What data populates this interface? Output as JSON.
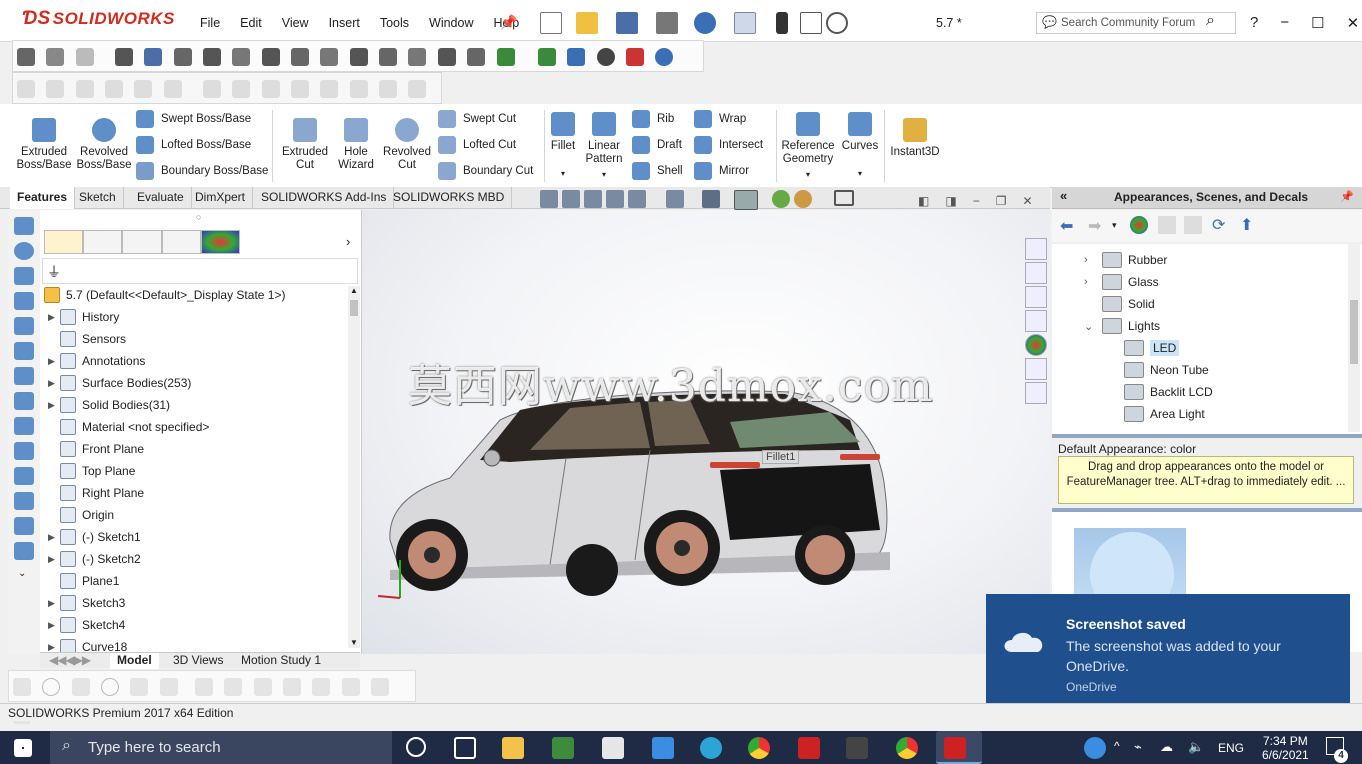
{
  "app": {
    "name": "SOLIDWORKS",
    "document_title": "5.7 *"
  },
  "menu": [
    "File",
    "Edit",
    "View",
    "Insert",
    "Tools",
    "Window",
    "Help"
  ],
  "search": {
    "placeholder": "Search Community Forum"
  },
  "command_manager": {
    "large": [
      {
        "label": "Extruded Boss/Base"
      },
      {
        "label": "Revolved Boss/Base"
      },
      {
        "label": "Extruded Cut"
      },
      {
        "label": "Hole Wizard"
      },
      {
        "label": "Revolved Cut"
      },
      {
        "label": "Fillet"
      },
      {
        "label": "Linear Pattern"
      },
      {
        "label": "Reference Geometry"
      },
      {
        "label": "Curves"
      },
      {
        "label": "Instant3D"
      }
    ],
    "small": [
      "Swept Boss/Base",
      "Lofted Boss/Base",
      "Boundary Boss/Base",
      "Swept Cut",
      "Lofted Cut",
      "Boundary Cut",
      "Rib",
      "Draft",
      "Shell",
      "Wrap",
      "Intersect",
      "Mirror"
    ]
  },
  "tabs": [
    "Features",
    "Sketch",
    "Evaluate",
    "DimXpert",
    "SOLIDWORKS Add-Ins",
    "SOLIDWORKS MBD"
  ],
  "feature_tree": {
    "root": "5.7  (Default<<Default>_Display State 1>)",
    "items": [
      {
        "label": "History",
        "expandable": true
      },
      {
        "label": "Sensors",
        "expandable": false
      },
      {
        "label": "Annotations",
        "expandable": true
      },
      {
        "label": "Surface Bodies(253)",
        "expandable": true
      },
      {
        "label": "Solid Bodies(31)",
        "expandable": true
      },
      {
        "label": "Material <not specified>",
        "expandable": false
      },
      {
        "label": "Front Plane",
        "expandable": false
      },
      {
        "label": "Top Plane",
        "expandable": false
      },
      {
        "label": "Right Plane",
        "expandable": false
      },
      {
        "label": "Origin",
        "expandable": false
      },
      {
        "label": "(-) Sketch1",
        "expandable": true
      },
      {
        "label": "(-) Sketch2",
        "expandable": true
      },
      {
        "label": "Plane1",
        "expandable": false
      },
      {
        "label": "Sketch3",
        "expandable": true
      },
      {
        "label": "Sketch4",
        "expandable": true
      },
      {
        "label": "Curve18",
        "expandable": true
      }
    ]
  },
  "viewport": {
    "watermark": "莫西网www.3dmox.com",
    "tooltip": "Fillet1"
  },
  "bottom_tabs": [
    "Model",
    "3D Views",
    "Motion Study 1"
  ],
  "right_panel": {
    "title": "Appearances, Scenes, and Decals",
    "tree": [
      {
        "label": "Rubber",
        "level": 0,
        "expander": "›"
      },
      {
        "label": "Glass",
        "level": 0,
        "expander": "›"
      },
      {
        "label": "Solid",
        "level": 0,
        "expander": ""
      },
      {
        "label": "Lights",
        "level": 0,
        "expander": "⌄"
      },
      {
        "label": "LED",
        "level": 1,
        "expander": "",
        "selected": true
      },
      {
        "label": "Neon Tube",
        "level": 1,
        "expander": ""
      },
      {
        "label": "Backlit LCD",
        "level": 1,
        "expander": ""
      },
      {
        "label": "Area Light",
        "level": 1,
        "expander": ""
      }
    ],
    "default_label": "Default Appearance: color",
    "info": "Drag and drop appearances onto the model or FeatureManager tree.  ALT+drag to immediately edit. ..."
  },
  "toast": {
    "title": "Screenshot saved",
    "body": "The screenshot was added to your OneDrive.",
    "source": "OneDrive"
  },
  "status": {
    "text": "SOLIDWORKS Premium 2017 x64 Edition"
  },
  "taskbar": {
    "search_placeholder": "Type here to search",
    "language": "ENG",
    "time": "7:34 PM",
    "date": "6/6/2021",
    "notification_count": "4"
  },
  "colors": {
    "brand": "#d52b1e",
    "toast": "#1f4f8d",
    "taskbar": "#1f2a44",
    "info": "#ffffcc"
  }
}
